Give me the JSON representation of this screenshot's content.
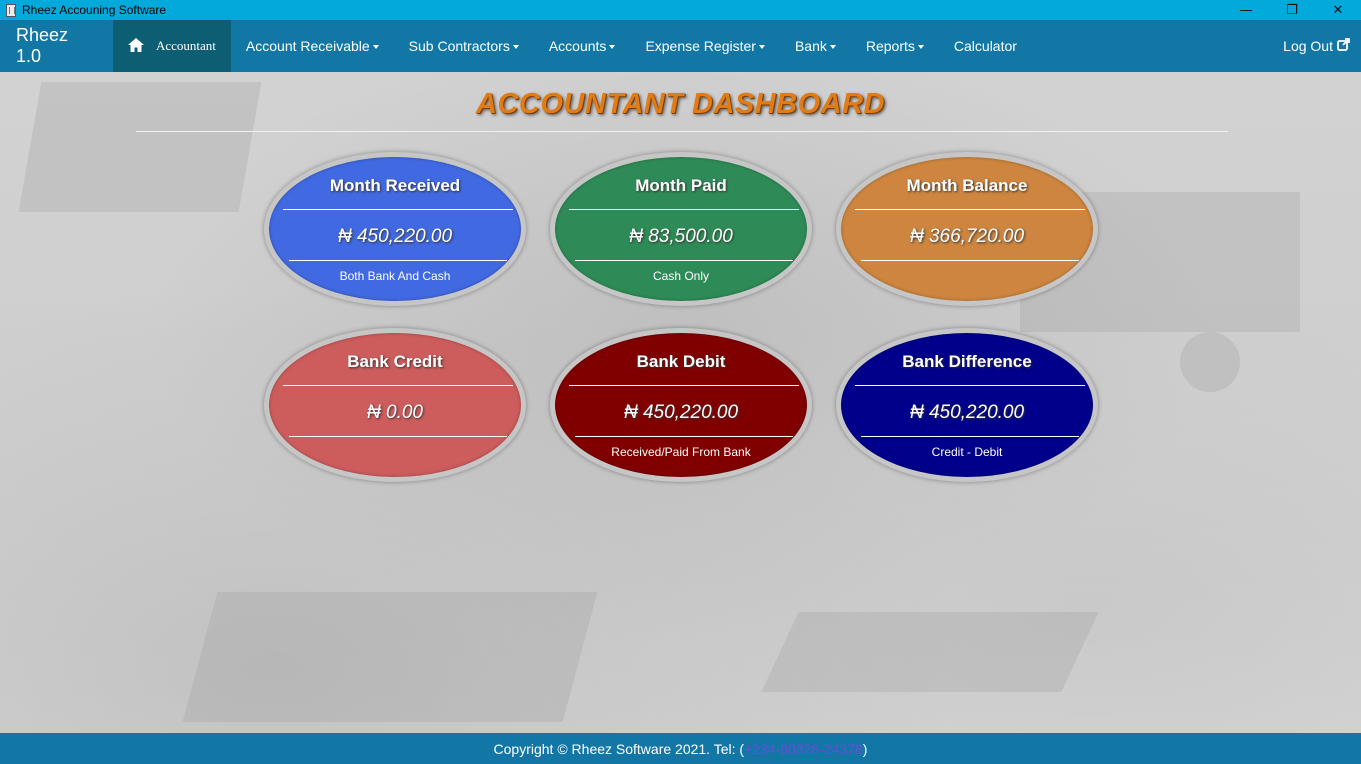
{
  "window": {
    "title": "Rheez Accouning Software",
    "controls": {
      "minimize": "—",
      "restore": "❐",
      "close": "✕"
    }
  },
  "navbar": {
    "brand": "Rheez 1.0",
    "home": {
      "icon": "home-icon",
      "label": "Accountant"
    },
    "items": [
      {
        "label": "Account Receivable",
        "dropdown": true
      },
      {
        "label": "Sub Contractors",
        "dropdown": true
      },
      {
        "label": "Accounts",
        "dropdown": true
      },
      {
        "label": "Expense Register",
        "dropdown": true
      },
      {
        "label": "Bank",
        "dropdown": true
      },
      {
        "label": "Reports",
        "dropdown": true
      },
      {
        "label": "Calculator",
        "dropdown": false
      }
    ],
    "logout": {
      "label": "Log Out",
      "icon": "external-link-icon"
    }
  },
  "dashboard": {
    "title": "ACCOUNTANT DASHBOARD",
    "cards": [
      {
        "title": "Month Received",
        "value": "₦ 450,220.00",
        "sub": "Both Bank And Cash",
        "color": "#4169e1"
      },
      {
        "title": "Month Paid",
        "value": "₦ 83,500.00",
        "sub": "Cash Only",
        "color": "#2e8b57"
      },
      {
        "title": "Month Balance",
        "value": "₦ 366,720.00",
        "sub": "",
        "color": "#cd853f"
      },
      {
        "title": "Bank Credit",
        "value": "₦ 0.00",
        "sub": "",
        "color": "#cd5c5c"
      },
      {
        "title": "Bank Debit",
        "value": "₦ 450,220.00",
        "sub": "Received/Paid From Bank",
        "color": "#800000"
      },
      {
        "title": "Bank Difference",
        "value": "₦ 450,220.00",
        "sub": "Credit - Debit",
        "color": "#00008b"
      }
    ]
  },
  "footer": {
    "prefix": "Copyright © Rheez Software 2021. Tel: (",
    "tel": "+234-80328-24378",
    "suffix": ")"
  }
}
